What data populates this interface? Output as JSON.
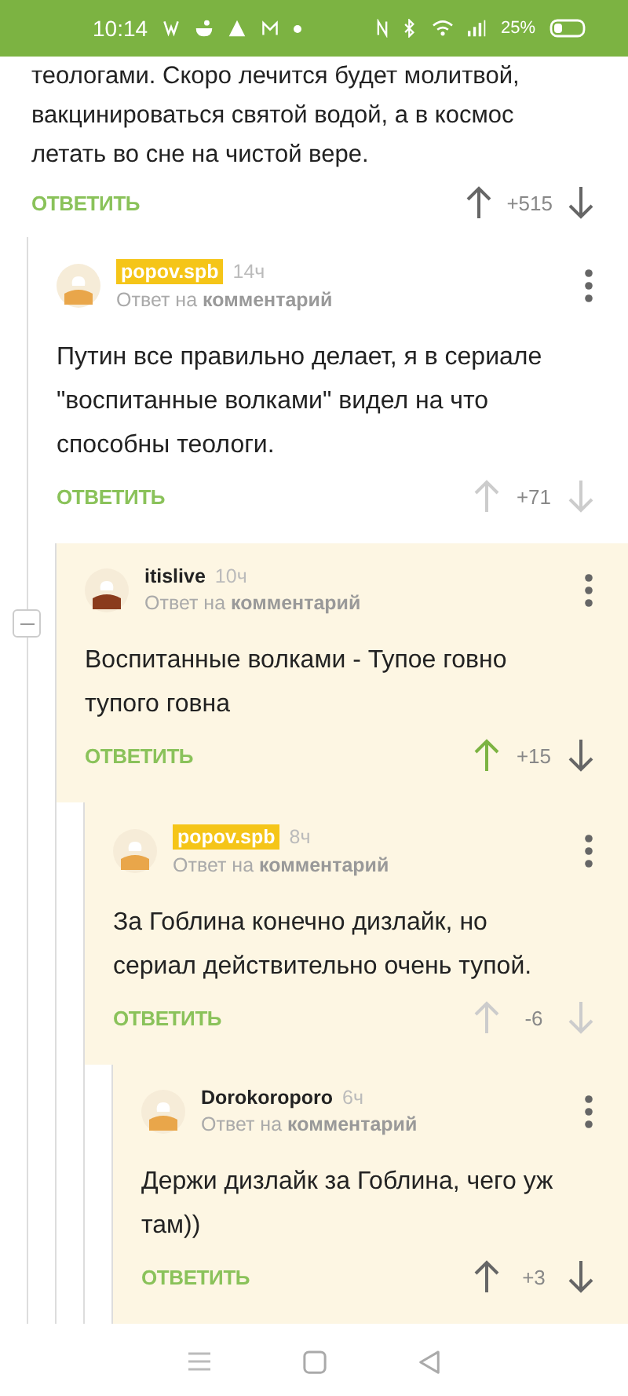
{
  "status_bar": {
    "time": "10:14",
    "battery": "25%"
  },
  "comment": {
    "text_cut": "теологами. Скоро лечится будет молитвой,",
    "text": "вакцинироваться святой водой, а в космос летать во сне на чистой вере.",
    "reply": "ОТВЕТИТЬ",
    "score": "+515",
    "upvoted": false,
    "votes_dim": false,
    "children": [
      {
        "avatar": {
          "color": "#e9a64a"
        },
        "author": "popov.spb",
        "author_badge": true,
        "time": "14ч",
        "reply_label": "Ответ на",
        "reply_target": "комментарий",
        "text": "Путин все правильно делает, я в сериале \"воспитанные волками\" видел на что способны теологи.",
        "reply": "ОТВЕТИТЬ",
        "score": "+71",
        "upvoted": false,
        "votes_dim": true,
        "highlighted": false,
        "children": [
          {
            "avatar": {
              "color": "#8a3b1c"
            },
            "author": "itislive",
            "author_badge": false,
            "time": "10ч",
            "reply_label": "Ответ на",
            "reply_target": "комментарий",
            "text": "Воспитанные волками - Тупое говно тупого говна",
            "reply": "ОТВЕТИТЬ",
            "score": "+15",
            "upvoted": true,
            "votes_dim": false,
            "highlighted": true,
            "collapsible": true,
            "children": [
              {
                "avatar": {
                  "color": "#e9a64a"
                },
                "author": "popov.spb",
                "author_badge": true,
                "time": "8ч",
                "reply_label": "Ответ на",
                "reply_target": "комментарий",
                "text": "За Гоблина конечно дизлайк, но сериал действительно очень тупой.",
                "reply": "ОТВЕТИТЬ",
                "score": "-6",
                "upvoted": false,
                "votes_dim": true,
                "highlighted": true,
                "children": [
                  {
                    "avatar": {
                      "color": "#e9a64a"
                    },
                    "author": "Dorokoroporo",
                    "author_badge": false,
                    "time": "6ч",
                    "reply_label": "Ответ на",
                    "reply_target": "комментарий",
                    "text": "Держи дизлайк за Гоблина, чего уж там))",
                    "reply": "ОТВЕТИТЬ",
                    "score": "+3",
                    "upvoted": false,
                    "votes_dim": false,
                    "highlighted": true
                  }
                ]
              }
            ]
          }
        ]
      }
    ]
  }
}
